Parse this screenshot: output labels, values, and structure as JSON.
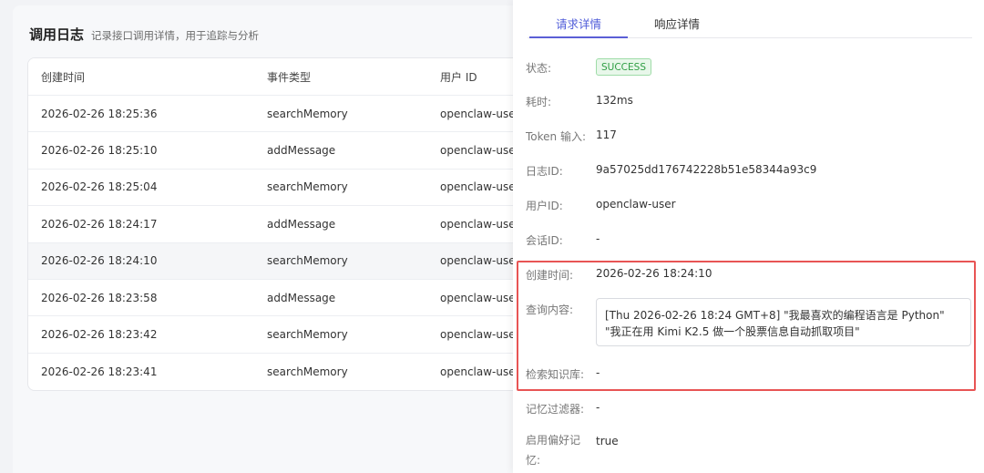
{
  "page": {
    "title": "调用日志",
    "subtitle": "记录接口调用详情，用于追踪与分析"
  },
  "table": {
    "headers": [
      "创建时间",
      "事件类型",
      "用户 ID"
    ],
    "rows": [
      {
        "time": "2026-02-26 18:25:36",
        "event": "searchMemory",
        "user": "openclaw-user"
      },
      {
        "time": "2026-02-26 18:25:10",
        "event": "addMessage",
        "user": "openclaw-user"
      },
      {
        "time": "2026-02-26 18:25:04",
        "event": "searchMemory",
        "user": "openclaw-user"
      },
      {
        "time": "2026-02-26 18:24:17",
        "event": "addMessage",
        "user": "openclaw-user"
      },
      {
        "time": "2026-02-26 18:24:10",
        "event": "searchMemory",
        "user": "openclaw-user"
      },
      {
        "time": "2026-02-26 18:23:58",
        "event": "addMessage",
        "user": "openclaw-user"
      },
      {
        "time": "2026-02-26 18:23:42",
        "event": "searchMemory",
        "user": "openclaw-user"
      },
      {
        "time": "2026-02-26 18:23:41",
        "event": "searchMemory",
        "user": "openclaw-user"
      }
    ]
  },
  "drawer": {
    "tabs": [
      "请求详情",
      "响应详情"
    ],
    "fields": {
      "status_label": "状态:",
      "status_value": "SUCCESS",
      "duration_label": "耗时:",
      "duration_value": "132ms",
      "token_label": "Token 输入:",
      "token_value": "117",
      "log_id_label": "日志ID:",
      "log_id_value": "9a57025dd176742228b51e58344a93c9",
      "user_id_label": "用户ID:",
      "user_id_value": "openclaw-user",
      "session_id_label": "会话ID:",
      "session_id_value": "-",
      "created_label": "创建时间:",
      "created_value": "2026-02-26 18:24:10",
      "query_label": "查询内容:",
      "query_value": "[Thu 2026-02-26 18:24 GMT+8] \"我最喜欢的编程语言是 Python\" \"我正在用 Kimi K2.5 做一个股票信息自动抓取项目\"",
      "kb_label": "检索知识库:",
      "kb_value": "-",
      "memory_filter_label": "记忆过滤器:",
      "memory_filter_value": "-",
      "pref_memory_label": "启用偏好记忆:",
      "pref_memory_value": "true"
    }
  },
  "colors": {
    "accent": "#4e5bd8",
    "success": "#2f9e44",
    "highlight_border": "#e85454"
  }
}
